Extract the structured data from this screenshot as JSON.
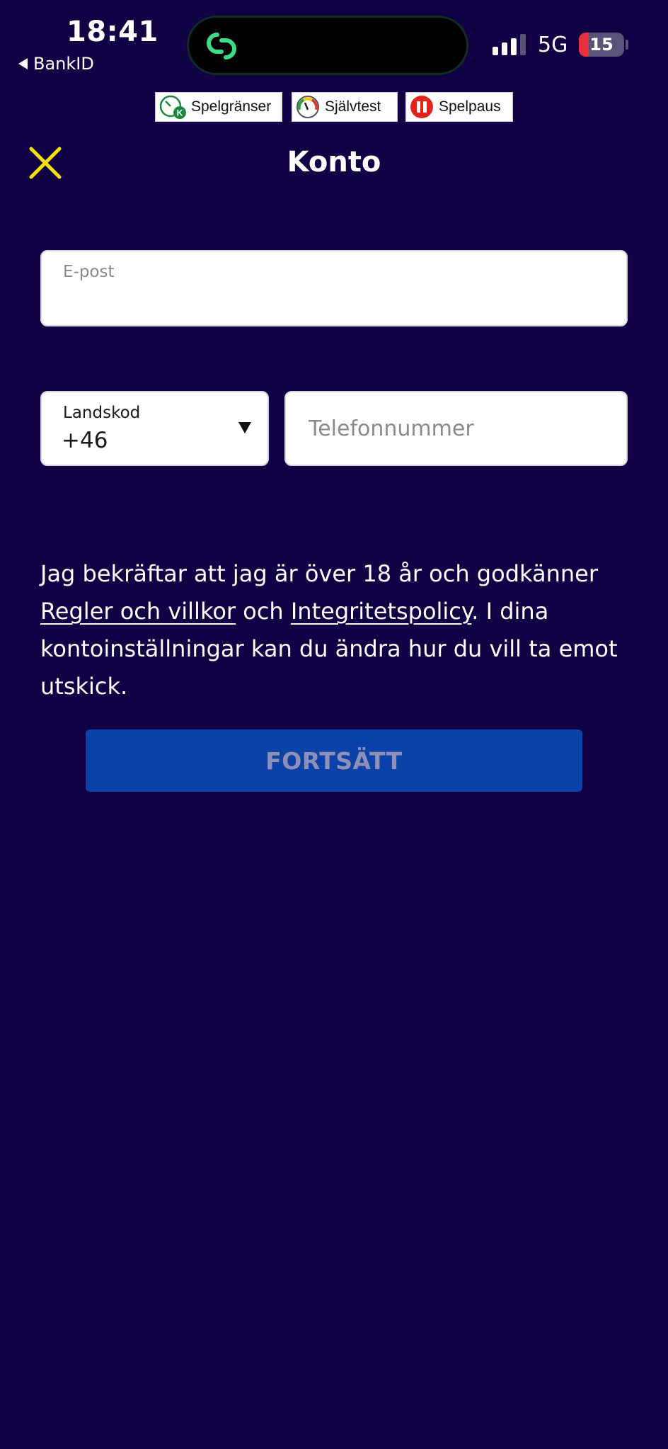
{
  "status_bar": {
    "time": "18:41",
    "back_app": "BankID",
    "network": "5G",
    "battery": "15",
    "icons": [
      "island-link-icon",
      "signal-icon",
      "battery-icon"
    ]
  },
  "badges": [
    {
      "label": "Spelgränser",
      "icon": "clock-limit-icon"
    },
    {
      "label": "Självtest",
      "icon": "gauge-icon"
    },
    {
      "label": "Spelpaus",
      "icon": "pause-icon"
    }
  ],
  "header": {
    "title": "Konto",
    "close_icon": "close-icon"
  },
  "form": {
    "email_label": "E-post",
    "email_value": "",
    "country_label": "Landskod",
    "country_value": "+46",
    "phone_placeholder": "Telefonnummer",
    "phone_value": ""
  },
  "consent": {
    "text_1": "Jag bekräftar att jag är över 18 år och godkänner ",
    "link_terms": "Regler och villkor",
    "text_2": " och ",
    "link_privacy": "Integritetspolicy",
    "text_3": ". I dina kontoinställningar kan du ändra hur du vill ta emot utskick."
  },
  "actions": {
    "continue_label": "FORTSÄTT"
  },
  "colors": {
    "background": "#120044",
    "accent_close": "#f5e10a",
    "button_bg": "#0a42a8",
    "button_text": "#8f8fb8",
    "island_icon": "#3ddc84"
  }
}
